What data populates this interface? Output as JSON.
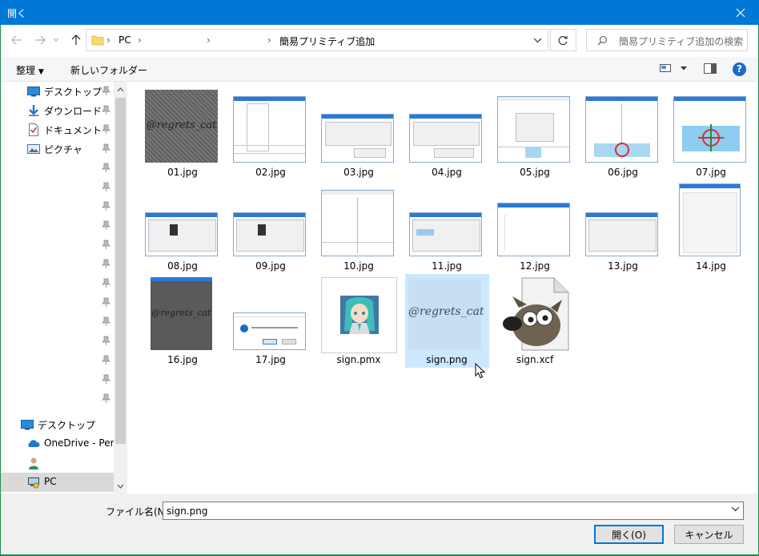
{
  "window": {
    "title": "開く"
  },
  "address": {
    "segments": [
      "PC",
      "",
      "簡易プリミティブ追加"
    ]
  },
  "search": {
    "placeholder": "簡易プリミティブ追加の検索"
  },
  "toolbar": {
    "organize": "整理",
    "new_folder": "新しいフォルダー"
  },
  "nav_pane": {
    "quick_access": [
      {
        "label": "デスクトップ",
        "icon": "desktop-icon"
      },
      {
        "label": "ダウンロード",
        "icon": "download-icon"
      },
      {
        "label": "ドキュメント",
        "icon": "documents-icon"
      },
      {
        "label": "ピクチャ",
        "icon": "pictures-icon"
      }
    ],
    "bottom_items": [
      {
        "label": "デスクトップ",
        "icon": "desktop-icon"
      },
      {
        "label": "OneDrive - Perso",
        "icon": "onedrive-icon"
      },
      {
        "label": "",
        "icon": "user-icon"
      },
      {
        "label": "PC",
        "icon": "pc-icon"
      }
    ]
  },
  "files": [
    {
      "name": "01.jpg",
      "kind": "signature-check"
    },
    {
      "name": "02.jpg",
      "kind": "screenshot-menu"
    },
    {
      "name": "03.jpg",
      "kind": "screenshot-dialog"
    },
    {
      "name": "04.jpg",
      "kind": "screenshot-dialog"
    },
    {
      "name": "05.jpg",
      "kind": "screenshot-grid"
    },
    {
      "name": "06.jpg",
      "kind": "screenshot-3d"
    },
    {
      "name": "07.jpg",
      "kind": "screenshot-3d-blue"
    },
    {
      "name": "08.jpg",
      "kind": "screenshot-dialog"
    },
    {
      "name": "09.jpg",
      "kind": "screenshot-dialog"
    },
    {
      "name": "10.jpg",
      "kind": "screenshot-grid"
    },
    {
      "name": "11.jpg",
      "kind": "screenshot-dialog"
    },
    {
      "name": "12.jpg",
      "kind": "screenshot-blank"
    },
    {
      "name": "13.jpg",
      "kind": "screenshot-dialog"
    },
    {
      "name": "14.jpg",
      "kind": "screenshot-tall"
    },
    {
      "name": "16.jpg",
      "kind": "signature-check-dark"
    },
    {
      "name": "17.jpg",
      "kind": "screenshot-msgbox"
    },
    {
      "name": "sign.pmx",
      "kind": "miku-model"
    },
    {
      "name": "sign.png",
      "kind": "signature-light"
    },
    {
      "name": "sign.xcf",
      "kind": "gimp-icon"
    }
  ],
  "signature_text": "@regrets_cat",
  "selected_file": "sign.png",
  "filename": {
    "label": "ファイル名(N):",
    "value": "sign.png"
  },
  "buttons": {
    "open": "開く(O)",
    "cancel": "キャンセル"
  },
  "colors": {
    "titlebar": "#0078d7",
    "selection": "#cce8ff",
    "frame": "#1f8d50"
  }
}
